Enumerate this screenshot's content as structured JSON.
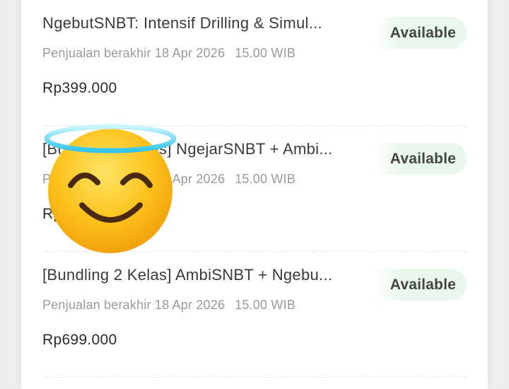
{
  "items": [
    {
      "title": "NgebutSNBT: Intensif Drilling & Simul...",
      "sale_end_label": "Penjualan berakhir 18 Apr 2026",
      "sale_end_time": "15.00 WIB",
      "price": "Rp399.000",
      "status": "Available"
    },
    {
      "title": "[Bundling 2 Kelas] NgejarSNBT + Ambi...",
      "sale_end_label": "Penjualan berakhir 18 Apr 2026",
      "sale_end_time": "15.00 WIB",
      "price": "Rp599.000",
      "status": "Available"
    },
    {
      "title": "[Bundling 2 Kelas] AmbiSNBT + Ngebu...",
      "sale_end_label": "Penjualan berakhir 18 Apr 2026",
      "sale_end_time": "15.00 WIB",
      "price": "Rp699.000",
      "status": "Available"
    }
  ],
  "overlay": {
    "icon": "smiling-face-with-halo-emoji"
  },
  "colors": {
    "badge_bg": "#e9f7ec",
    "title": "#3a3a3a",
    "meta": "#9a9a9a"
  }
}
